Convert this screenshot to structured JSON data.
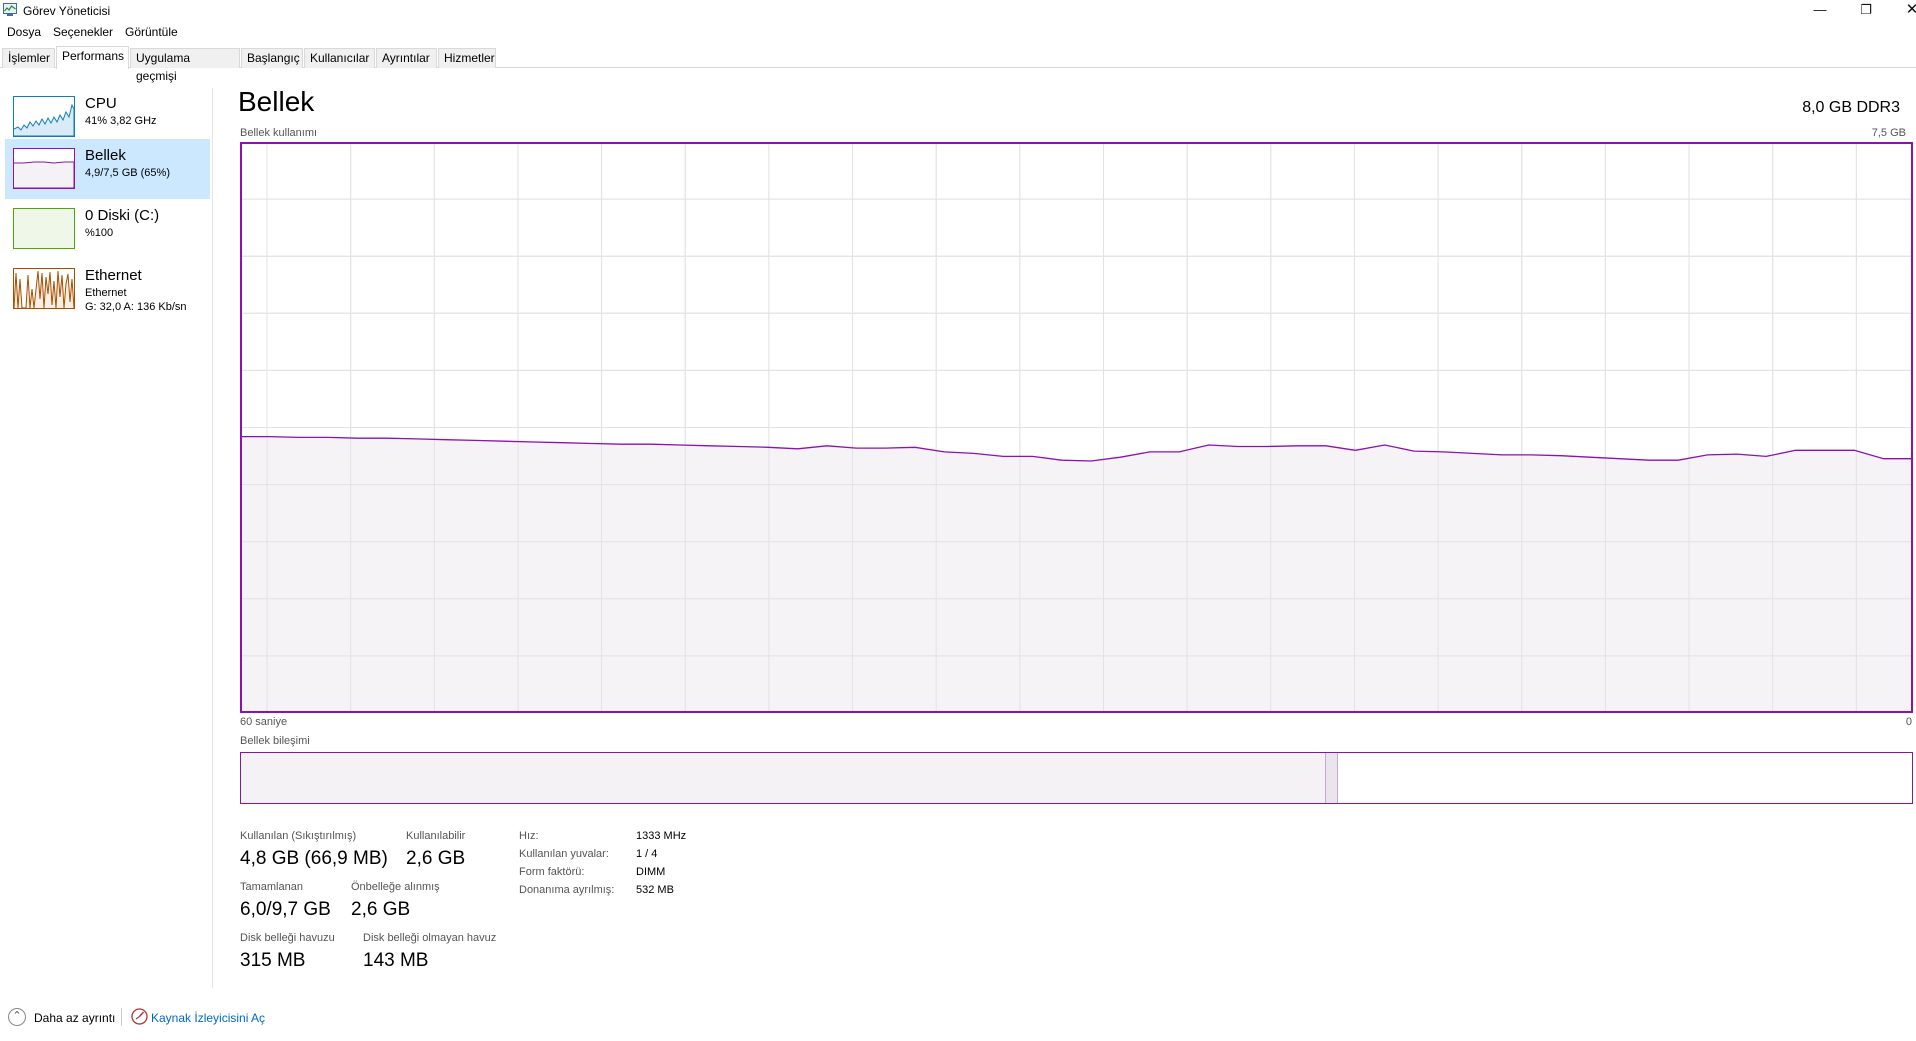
{
  "window": {
    "title": "Görev Yöneticisi",
    "controls": {
      "minimize": "—",
      "maximize": "❐",
      "close": "✕"
    }
  },
  "menu": [
    "Dosya",
    "Seçenekler",
    "Görüntüle"
  ],
  "tabs": [
    {
      "label": "İşlemler",
      "active": false
    },
    {
      "label": "Performans",
      "active": true
    },
    {
      "label": "Uygulama geçmişi",
      "active": false
    },
    {
      "label": "Başlangıç",
      "active": false
    },
    {
      "label": "Kullanıcılar",
      "active": false
    },
    {
      "label": "Ayrıntılar",
      "active": false
    },
    {
      "label": "Hizmetler",
      "active": false
    }
  ],
  "sidebar": {
    "items": [
      {
        "title": "CPU",
        "sub": "41% 3,82 GHz",
        "sub2": "",
        "color": "#117dbb",
        "selected": false
      },
      {
        "title": "Bellek",
        "sub": "4,9/7,5 GB (65%)",
        "sub2": "",
        "color": "#8b12ae",
        "selected": true
      },
      {
        "title": "0 Diski (C:)",
        "sub": "%100",
        "sub2": "",
        "color": "#4da60c",
        "selected": false
      },
      {
        "title": "Ethernet",
        "sub": "Ethernet",
        "sub2": "G: 32,0  A: 136 Kb/sn",
        "color": "#a74f01",
        "selected": false
      }
    ]
  },
  "main": {
    "title": "Bellek",
    "spec": "8,0 GB DDR3",
    "graph_label": "Bellek kullanımı",
    "graph_max": "7,5 GB",
    "axis_left": "60 saniye",
    "axis_right": "0",
    "composition_label": "Bellek bileşimi",
    "composition": {
      "in_use_fraction": 0.649,
      "modified_fraction": 0.008
    },
    "usage_series": [
      3.63,
      3.63,
      3.62,
      3.62,
      3.61,
      3.61,
      3.6,
      3.59,
      3.58,
      3.57,
      3.56,
      3.55,
      3.54,
      3.53,
      3.53,
      3.52,
      3.51,
      3.5,
      3.49,
      3.47,
      3.51,
      3.48,
      3.48,
      3.49,
      3.43,
      3.41,
      3.37,
      3.37,
      3.32,
      3.31,
      3.36,
      3.43,
      3.43,
      3.52,
      3.5,
      3.5,
      3.51,
      3.51,
      3.45,
      3.52,
      3.44,
      3.43,
      3.41,
      3.39,
      3.39,
      3.38,
      3.36,
      3.34,
      3.32,
      3.32,
      3.39,
      3.4,
      3.37,
      3.45,
      3.45,
      3.45,
      3.34,
      3.34
    ],
    "colors": {
      "line": "#8b12ae",
      "fill": "#f4f2f4",
      "grid": "#e3e3e3"
    },
    "stats": {
      "in_use_label": "Kullanılan (Sıkıştırılmış)",
      "in_use_value": "4,8 GB (66,9 MB)",
      "available_label": "Kullanılabilir",
      "available_value": "2,6 GB",
      "committed_label": "Tamamlanan",
      "committed_value": "6,0/9,7 GB",
      "cached_label": "Önbelleğe alınmış",
      "cached_value": "2,6 GB",
      "paged_label": "Disk belleği havuzu",
      "paged_value": "315 MB",
      "nonpaged_label": "Disk belleği olmayan havuz",
      "nonpaged_value": "143 MB"
    },
    "props": {
      "speed_label": "Hız:",
      "speed_value": "1333 MHz",
      "slots_label": "Kullanılan yuvalar:",
      "slots_value": "1 / 4",
      "form_label": "Form faktörü:",
      "form_value": "DIMM",
      "reserved_label": "Donanıma ayrılmış:",
      "reserved_value": "532 MB"
    }
  },
  "footer": {
    "less_details": "Daha az ayrıntı",
    "open_monitor": "Kaynak İzleyicisini Aç"
  }
}
